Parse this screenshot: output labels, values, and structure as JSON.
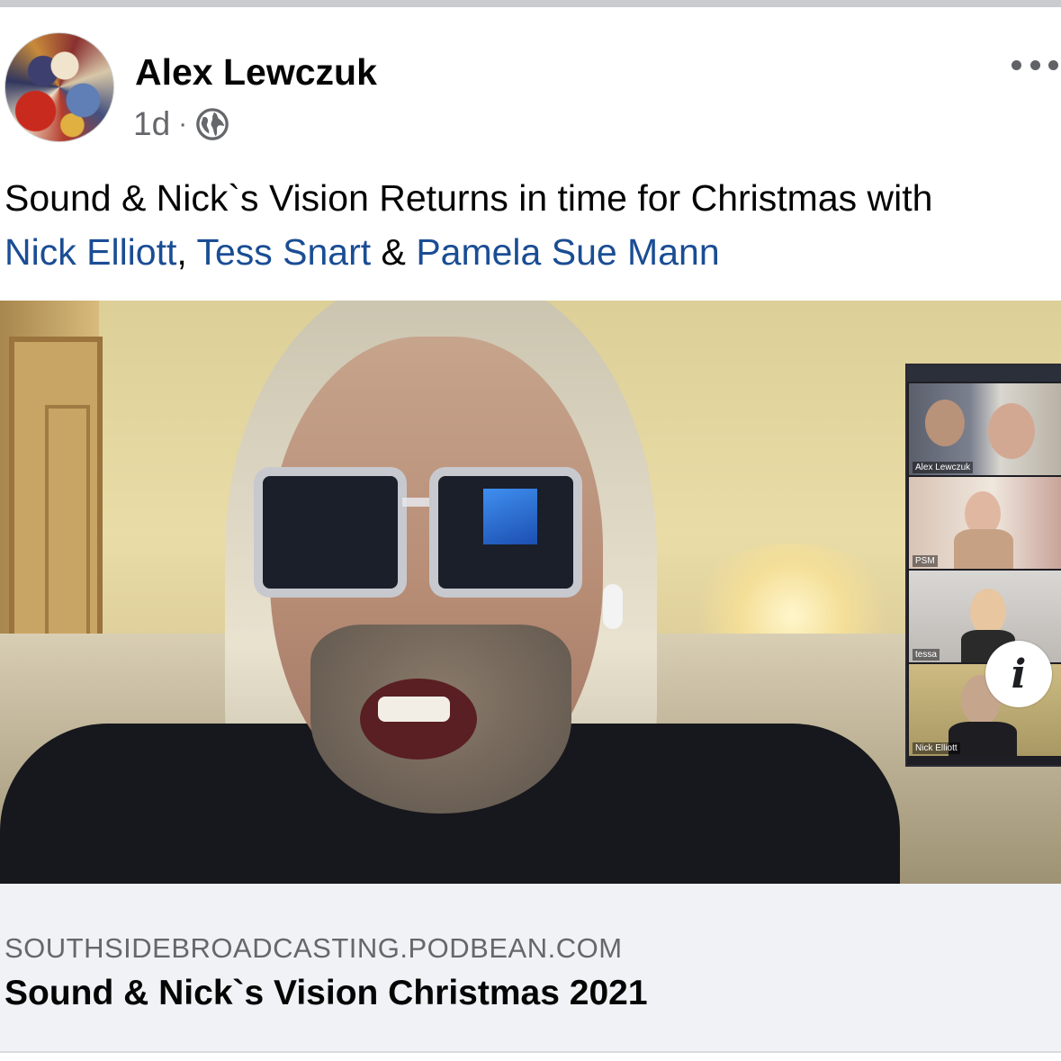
{
  "post": {
    "author": "Alex Lewczuk",
    "time": "1d",
    "separator": "·",
    "privacy_icon": "globe-icon",
    "more_icon": "more-horizontal-icon",
    "text_line1": "Sound & Nick`s Vision Returns in time for Christmas with",
    "mention_1": "Nick Elliott",
    "comma": ",",
    "mention_2": "Tess Snart",
    "ampersand": "&",
    "mention_3": "Pamela Sue Mann"
  },
  "media": {
    "info_icon_label": "i",
    "participants": [
      "Alex Lewczuk",
      "PSM",
      "tessa",
      "Nick Elliott"
    ]
  },
  "link": {
    "domain": "SOUTHSIDEBROADCASTING.PODBEAN.COM",
    "title": "Sound & Nick`s Vision Christmas 2021"
  },
  "colors": {
    "mention": "#1a4d94",
    "meta": "#65676b",
    "link_card_bg": "#f0f2f5"
  }
}
